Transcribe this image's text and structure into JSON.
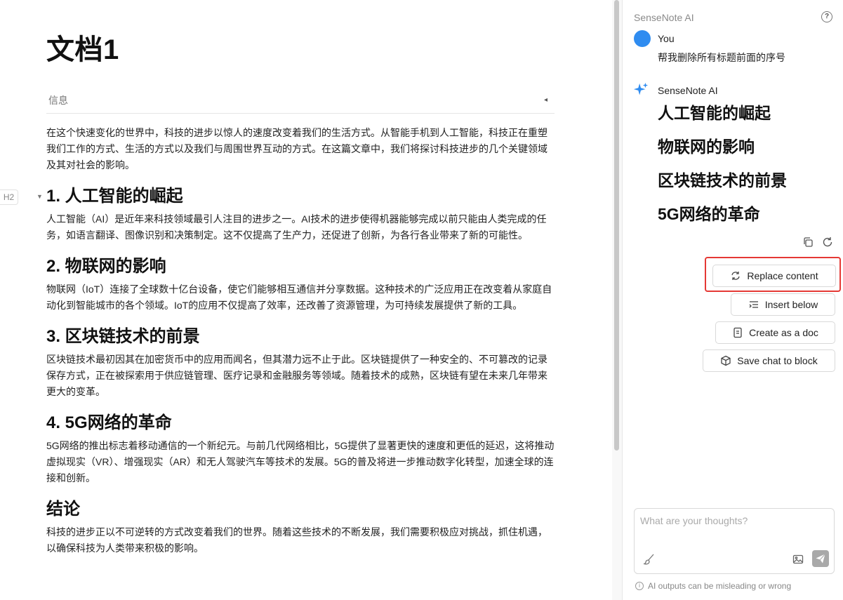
{
  "editor": {
    "title": "文档1",
    "info_label": "信息",
    "info_toggle": "◂",
    "block_badge": "H2",
    "caret": "▼",
    "intro": "在这个快速变化的世界中，科技的进步以惊人的速度改变着我们的生活方式。从智能手机到人工智能，科技正在重塑我们工作的方式、生活的方式以及我们与周围世界互动的方式。在这篇文章中，我们将探讨科技进步的几个关键领域及其对社会的影响。",
    "sections": [
      {
        "heading": "1. 人工智能的崛起",
        "body": "人工智能（AI）是近年来科技领域最引人注目的进步之一。AI技术的进步使得机器能够完成以前只能由人类完成的任务，如语言翻译、图像识别和决策制定。这不仅提高了生产力，还促进了创新，为各行各业带来了新的可能性。"
      },
      {
        "heading": "2. 物联网的影响",
        "body": "物联网（IoT）连接了全球数十亿台设备，使它们能够相互通信并分享数据。这种技术的广泛应用正在改变着从家庭自动化到智能城市的各个领域。IoT的应用不仅提高了效率，还改善了资源管理，为可持续发展提供了新的工具。"
      },
      {
        "heading": "3. 区块链技术的前景",
        "body": "区块链技术最初因其在加密货币中的应用而闻名，但其潜力远不止于此。区块链提供了一种安全的、不可篡改的记录保存方式，正在被探索用于供应链管理、医疗记录和金融服务等领域。随着技术的成熟，区块链有望在未来几年带来更大的变革。"
      },
      {
        "heading": "4. 5G网络的革命",
        "body": "5G网络的推出标志着移动通信的一个新纪元。与前几代网络相比，5G提供了显著更快的速度和更低的延迟，这将推动虚拟现实（VR）、增强现实（AR）和无人驾驶汽车等技术的发展。5G的普及将进一步推动数字化转型，加速全球的连接和创新。"
      },
      {
        "heading": "结论",
        "body": "科技的进步正以不可逆转的方式改变着我们的世界。随着这些技术的不断发展，我们需要积极应对挑战，抓住机遇，以确保科技为人类带来积极的影响。"
      }
    ]
  },
  "panel": {
    "title": "SenseNote AI",
    "help": "?",
    "user_name": "You",
    "user_message": "帮我删除所有标题前面的序号",
    "ai_name": "SenseNote AI",
    "ai_headings": [
      "人工智能的崛起",
      "物联网的影响",
      "区块链技术的前景",
      "5G网络的革命"
    ],
    "buttons": {
      "replace": "Replace content",
      "insert": "Insert below",
      "create": "Create as a doc",
      "save": "Save chat to block"
    },
    "input_placeholder": "What are your thoughts?",
    "disclaimer": "AI outputs can be misleading or wrong",
    "info_glyph": "i"
  },
  "colors": {
    "avatar": "#2f8cf0",
    "highlight": "#e53935",
    "ai_star": "#2f8cf0"
  }
}
